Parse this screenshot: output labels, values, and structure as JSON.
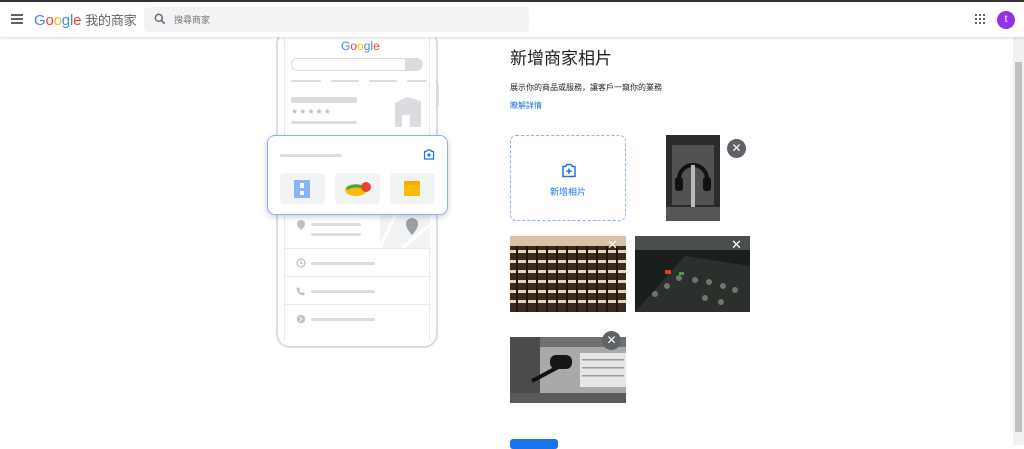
{
  "header": {
    "logo_letters": [
      "G",
      "o",
      "o",
      "g",
      "l",
      "e"
    ],
    "product_name": "我的商家",
    "search_placeholder": "搜尋商家",
    "avatar_initial": "t"
  },
  "preview": {
    "google_letters": [
      "G",
      "o",
      "o",
      "g",
      "l",
      "e"
    ]
  },
  "main": {
    "title": "新增商家相片",
    "description": "展示你的商品或服務，讓客戶一窺你的業務",
    "learn_more": "瞭解詳情",
    "add_photo_label": "新增相片"
  },
  "icons": {
    "menu": "menu-icon",
    "search": "search-icon",
    "apps": "apps-grid-icon",
    "add_photo": "add-photo-icon",
    "close": "close-icon"
  },
  "colors": {
    "accent": "#1a73e8",
    "avatar": "#9334e6",
    "dashed_border": "#8ab4f8"
  }
}
